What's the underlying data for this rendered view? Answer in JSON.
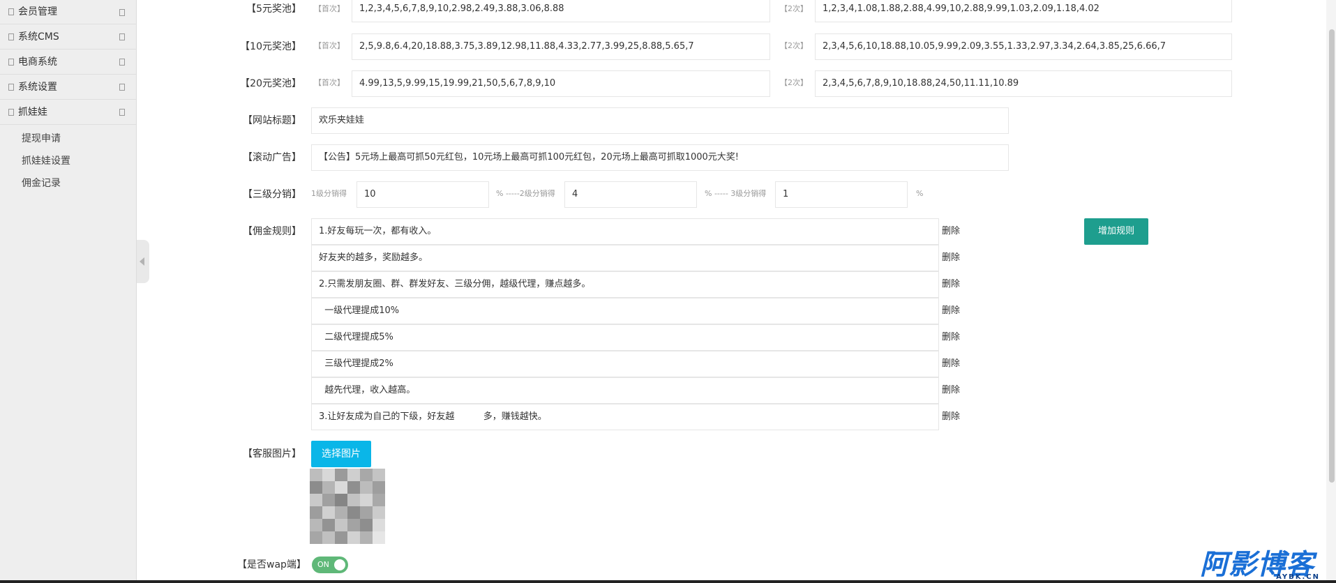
{
  "sidebar": {
    "items": [
      {
        "label": "会员管理"
      },
      {
        "label": "系统CMS"
      },
      {
        "label": "电商系统"
      },
      {
        "label": "系统设置"
      },
      {
        "label": "抓娃娃"
      }
    ],
    "sub_items": [
      {
        "label": "提现申请"
      },
      {
        "label": "抓娃娃设置"
      },
      {
        "label": "佣金记录"
      }
    ]
  },
  "form": {
    "pool5": {
      "label": "【5元奖池】",
      "hint_first": "【首次】",
      "first": "1,2,3,4,5,6,7,8,9,10,2.98,2.49,3.88,3.06,8.88",
      "hint_second": "【2次】",
      "second": "1,2,3,4,1.08,1.88,2.88,4.99,10,2.88,9.99,1.03,2.09,1.18,4.02"
    },
    "pool10": {
      "label": "【10元奖池】",
      "hint_first": "【首次】",
      "first": "2,5,9.8,6.4,20,18.88,3.75,3.89,12.98,11.88,4.33,2.77,3.99,25,8.88,5.65,7",
      "hint_second": "【2次】",
      "second": "2,3,4,5,6,10,18.88,10.05,9.99,2.09,3.55,1.33,2.97,3.34,2.64,3.85,25,6.66,7"
    },
    "pool20": {
      "label": "【20元奖池】",
      "hint_first": "【首次】",
      "first": "4.99,13,5,9.99,15,19.99,21,50,5,6,7,8,9,10",
      "hint_second": "【2次】",
      "second": "2,3,4,5,6,7,8,9,10,18.88,24,50,11.11,10.89"
    },
    "site_title": {
      "label": "【网站标题】",
      "value": "欢乐夹娃娃"
    },
    "marquee": {
      "label": "【滚动广告】",
      "value": "【公告】5元场上最高可抓50元红包，10元场上最高可抓100元红包，20元场上最高可抓取1000元大奖!"
    },
    "distribution": {
      "label": "【三级分销】",
      "l1_hint": "1级分销得",
      "l1_value": "10",
      "l2_hint": "% -----2级分销得",
      "l2_value": "4",
      "l3_hint": "% ----- 3级分销得",
      "l3_value": "1",
      "suffix": "%"
    },
    "commission": {
      "label": "【佣金规则】",
      "delete_label": "删除",
      "add_button": "增加规则",
      "rules": [
        "1.好友每玩一次，都有收入。",
        "好友夹的越多，奖励越多。",
        "2.只需发朋友圈、群、群发好友、三级分佣，越级代理，赚点越多。",
        "  一级代理提成10%",
        "  二级代理提成5%",
        "  三级代理提成2%",
        "  越先代理，收入越高。",
        "3.让好友成为自己的下级，好友越          多，赚钱越快。"
      ]
    },
    "service_image": {
      "label": "【客服图片】",
      "button": "选择图片"
    },
    "wap": {
      "label": "【是否wap端】",
      "toggle_text": "ON"
    }
  },
  "watermark": {
    "text": "阿影博客",
    "sub": "AYBK.CN"
  },
  "colors": {
    "add_button": "#1e9e8e",
    "choose_button": "#0ab6e8",
    "toggle_on": "#5fb878",
    "watermark": "#1a6fd6"
  }
}
